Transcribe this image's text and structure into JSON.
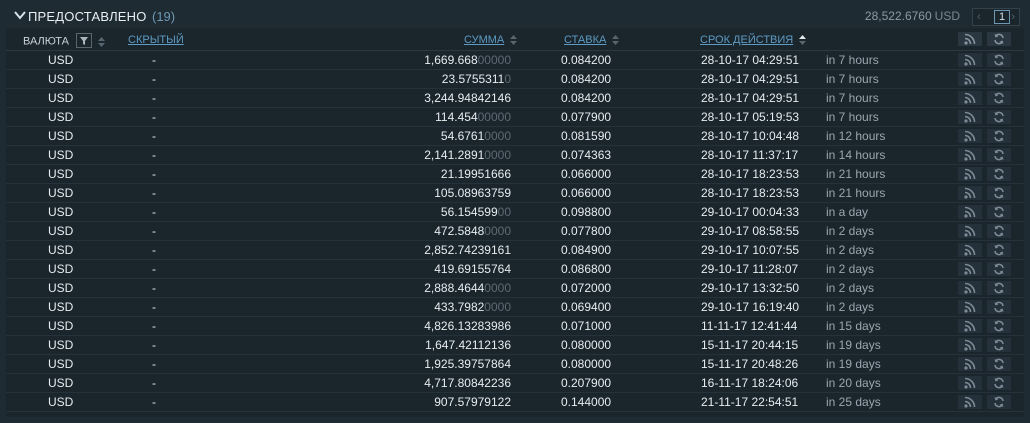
{
  "panel": {
    "title": "ПРЕДОСТАВЛЕНО",
    "count": "(19)",
    "total_value": "28,522.6760",
    "total_currency": "USD",
    "page": "1",
    "prev_symbol": "‹",
    "next_symbol": "›"
  },
  "headers": {
    "currency": "ВАЛЮТА",
    "hidden": "СКРЫТЫЙ",
    "amount": "СУММА",
    "rate": "СТАВКА",
    "expiry": "СРОК ДЕЙСТВИЯ"
  },
  "colors": {
    "background": "#1b252c",
    "link": "#5d9bc4",
    "dim_digits": "#5d6a74",
    "relative_time": "#9aa7b0"
  },
  "icons": {
    "collapse": "chevron-down-icon",
    "filter": "filter-icon",
    "sort": "sort-icon",
    "rss": "rss-icon",
    "refresh": "refresh-icon"
  },
  "rows": [
    {
      "currency": "USD",
      "hidden": "-",
      "amount_main": "1,669.668",
      "amount_dim": "00000",
      "rate": "0.084200",
      "date": "28-10-17 04:29:51",
      "relative": "in 7 hours"
    },
    {
      "currency": "USD",
      "hidden": "-",
      "amount_main": "23.5755311",
      "amount_dim": "0",
      "rate": "0.084200",
      "date": "28-10-17 04:29:51",
      "relative": "in 7 hours"
    },
    {
      "currency": "USD",
      "hidden": "-",
      "amount_main": "3,244.94842146",
      "amount_dim": "",
      "rate": "0.084200",
      "date": "28-10-17 04:29:51",
      "relative": "in 7 hours"
    },
    {
      "currency": "USD",
      "hidden": "-",
      "amount_main": "114.454",
      "amount_dim": "00000",
      "rate": "0.077900",
      "date": "28-10-17 05:19:53",
      "relative": "in 7 hours"
    },
    {
      "currency": "USD",
      "hidden": "-",
      "amount_main": "54.6761",
      "amount_dim": "0000",
      "rate": "0.081590",
      "date": "28-10-17 10:04:48",
      "relative": "in 12 hours"
    },
    {
      "currency": "USD",
      "hidden": "-",
      "amount_main": "2,141.2891",
      "amount_dim": "0000",
      "rate": "0.074363",
      "date": "28-10-17 11:37:17",
      "relative": "in 14 hours"
    },
    {
      "currency": "USD",
      "hidden": "-",
      "amount_main": "21.19951666",
      "amount_dim": "",
      "rate": "0.066000",
      "date": "28-10-17 18:23:53",
      "relative": "in 21 hours"
    },
    {
      "currency": "USD",
      "hidden": "-",
      "amount_main": "105.08963759",
      "amount_dim": "",
      "rate": "0.066000",
      "date": "28-10-17 18:23:53",
      "relative": "in 21 hours"
    },
    {
      "currency": "USD",
      "hidden": "-",
      "amount_main": "56.154599",
      "amount_dim": "00",
      "rate": "0.098800",
      "date": "29-10-17 00:04:33",
      "relative": "in a day"
    },
    {
      "currency": "USD",
      "hidden": "-",
      "amount_main": "472.5848",
      "amount_dim": "0000",
      "rate": "0.077800",
      "date": "29-10-17 08:58:55",
      "relative": "in 2 days"
    },
    {
      "currency": "USD",
      "hidden": "-",
      "amount_main": "2,852.74239161",
      "amount_dim": "",
      "rate": "0.084900",
      "date": "29-10-17 10:07:55",
      "relative": "in 2 days"
    },
    {
      "currency": "USD",
      "hidden": "-",
      "amount_main": "419.69155764",
      "amount_dim": "",
      "rate": "0.086800",
      "date": "29-10-17 11:28:07",
      "relative": "in 2 days"
    },
    {
      "currency": "USD",
      "hidden": "-",
      "amount_main": "2,888.4644",
      "amount_dim": "0000",
      "rate": "0.072000",
      "date": "29-10-17 13:32:50",
      "relative": "in 2 days"
    },
    {
      "currency": "USD",
      "hidden": "-",
      "amount_main": "433.7982",
      "amount_dim": "0000",
      "rate": "0.069400",
      "date": "29-10-17 16:19:40",
      "relative": "in 2 days"
    },
    {
      "currency": "USD",
      "hidden": "-",
      "amount_main": "4,826.13283986",
      "amount_dim": "",
      "rate": "0.071000",
      "date": "11-11-17 12:41:44",
      "relative": "in 15 days"
    },
    {
      "currency": "USD",
      "hidden": "-",
      "amount_main": "1,647.42112136",
      "amount_dim": "",
      "rate": "0.080000",
      "date": "15-11-17 20:44:15",
      "relative": "in 19 days"
    },
    {
      "currency": "USD",
      "hidden": "-",
      "amount_main": "1,925.39757864",
      "amount_dim": "",
      "rate": "0.080000",
      "date": "15-11-17 20:48:26",
      "relative": "in 19 days"
    },
    {
      "currency": "USD",
      "hidden": "-",
      "amount_main": "4,717.80842236",
      "amount_dim": "",
      "rate": "0.207900",
      "date": "16-11-17 18:24:06",
      "relative": "in 20 days"
    },
    {
      "currency": "USD",
      "hidden": "-",
      "amount_main": "907.57979122",
      "amount_dim": "",
      "rate": "0.144000",
      "date": "21-11-17 22:54:51",
      "relative": "in 25 days"
    }
  ]
}
